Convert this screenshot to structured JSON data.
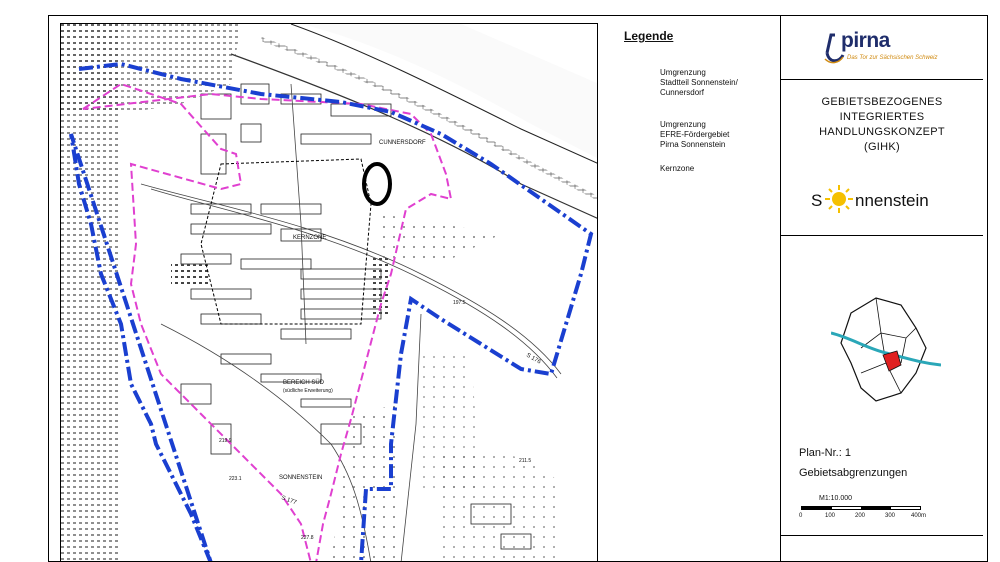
{
  "legend": {
    "title": "Legende",
    "items": [
      {
        "label_1": "Umgrenzung",
        "label_2": "Stadtteil Sonnenstein/",
        "label_3": "Cunnersdorf",
        "color": "#1a3fd0",
        "style": "dashdot-bold"
      },
      {
        "label_1": "Umgrenzung",
        "label_2": "EFRE-Fördergebiet",
        "label_3": "Pirna Sonnenstein",
        "color": "#e040d0",
        "style": "dashed"
      },
      {
        "label_1": "Kernzone",
        "color": "#000000",
        "style": "dashed-thin"
      }
    ]
  },
  "title_block": {
    "logo_text": "pirna",
    "logo_sub": "Das Tor zur Sächsischen Schweiz",
    "gihk_line_1": "GEBIETSBEZOGENES",
    "gihk_line_2": "INTEGRIERTES",
    "gihk_line_3": "HANDLUNGSKONZEPT",
    "gihk_line_4": "(GIHK)",
    "sonnen_left": "S",
    "sonnen_right": "nnenstein",
    "plan_nr": "Plan-Nr.: 1",
    "plan_title": "Gebietsabgrenzungen",
    "scale": "M1:10.000",
    "scale_ticks": [
      "0",
      "100",
      "200",
      "300",
      "400m"
    ]
  },
  "map_labels": {
    "cunnersdorf": "CUNNERSDORF",
    "kernzone": "KERNZONE",
    "bereich_sud_1": "BEREICH SÜD",
    "bereich_sud_2": "(südliche Erweiterung)",
    "sonnenstein": "SONNENSTEIN",
    "road": "S 176",
    "road2": "S 177",
    "elev_1": "197.5",
    "elev_2": "219.9",
    "elev_3": "223.1",
    "elev_4": "211.5",
    "elev_5": "227.8"
  },
  "colors": {
    "boundary_blue": "#1a3fd0",
    "efre_magenta": "#e040d0",
    "sun_yellow": "#f5c000",
    "locator_red": "#e02020",
    "river_teal": "#2aa7b8"
  }
}
